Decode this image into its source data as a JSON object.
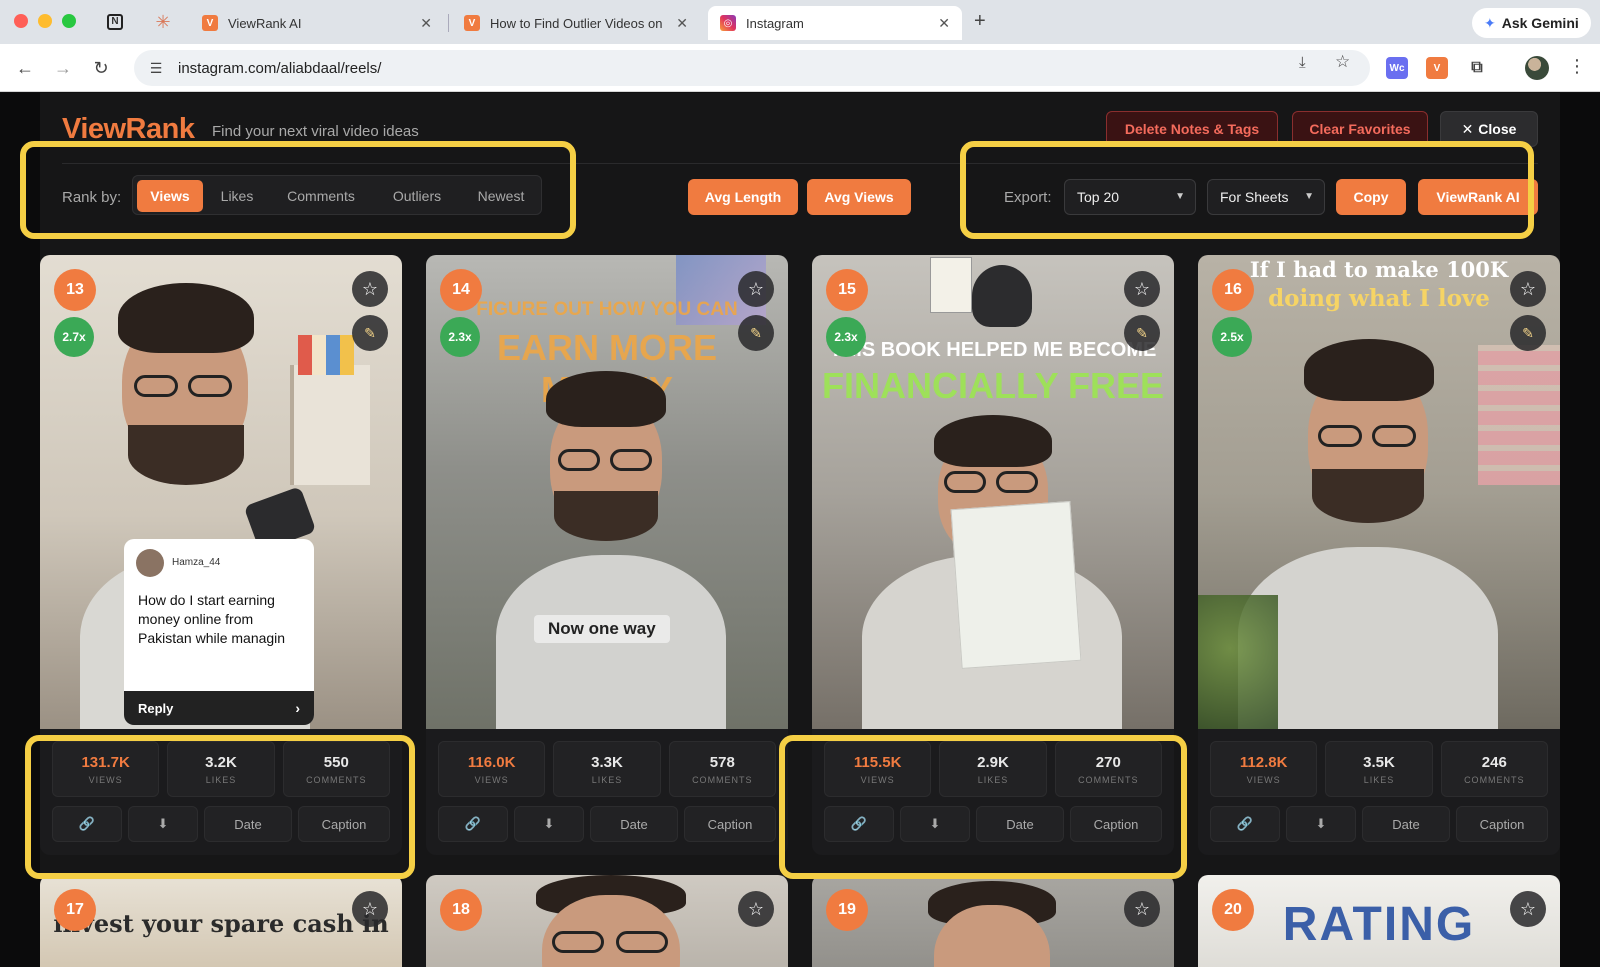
{
  "browser": {
    "tabs": [
      {
        "title": "ViewRank AI"
      },
      {
        "title": "How to Find Outlier Videos on"
      },
      {
        "title": "Instagram"
      }
    ],
    "new_tab_symbol": "+",
    "ask_gemini": "Ask Gemini",
    "url": "instagram.com/aliabdaal/reels/"
  },
  "app": {
    "brand": "ViewRank",
    "tagline": "Find your next viral video ideas",
    "delete_notes": "Delete Notes & Tags",
    "clear_favorites": "Clear Favorites",
    "close": "Close",
    "rank_label": "Rank by:",
    "rank_options": [
      "Views",
      "Likes",
      "Comments",
      "Outliers",
      "Newest"
    ],
    "rank_active": "Views",
    "avg_length": "Avg Length",
    "avg_views": "Avg Views",
    "export_label": "Export:",
    "export_count": "Top 20",
    "export_format": "For Sheets",
    "copy": "Copy",
    "viewrank_ai": "ViewRank AI"
  },
  "stat_labels": {
    "views": "VIEWS",
    "likes": "LIKES",
    "comments": "COMMENTS"
  },
  "action_labels": {
    "date": "Date",
    "caption": "Caption"
  },
  "cards": [
    {
      "rank": "13",
      "multiplier": "2.7x",
      "views": "131.7K",
      "likes": "3.2K",
      "comments": "550",
      "comment_user": "Hamza_44",
      "comment_text": "How do I start earning money online from Pakistan while managin",
      "reply": "Reply"
    },
    {
      "rank": "14",
      "multiplier": "2.3x",
      "views": "116.0K",
      "likes": "3.3K",
      "comments": "578",
      "overlay_top": "FIGURE OUT HOW YOU CAN",
      "overlay_main": "EARN MORE MONEY",
      "caption": "Now one way"
    },
    {
      "rank": "15",
      "multiplier": "2.3x",
      "views": "115.5K",
      "likes": "2.9K",
      "comments": "270",
      "overlay_top": "THIS BOOK HELPED ME BECOME",
      "overlay_main": "FINANCIALLY FREE"
    },
    {
      "rank": "16",
      "multiplier": "2.5x",
      "views": "112.8K",
      "likes": "3.5K",
      "comments": "246",
      "overlay_top": "If I had to make 100K",
      "overlay_main": "doing what I love"
    }
  ],
  "cards_row2": [
    {
      "rank": "17",
      "overlay": "invest your spare cash in"
    },
    {
      "rank": "18"
    },
    {
      "rank": "19"
    },
    {
      "rank": "20",
      "overlay": "RATING"
    }
  ],
  "icons": {
    "star": "star-icon",
    "note": "note-icon",
    "link": "link-icon",
    "download": "download-icon"
  },
  "colors": {
    "accent": "#f07b40",
    "outlier": "#3ba956",
    "highlight": "#f5cf45",
    "danger": "#f46b5c"
  }
}
